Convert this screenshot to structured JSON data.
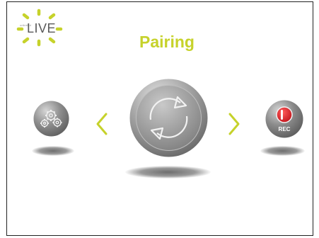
{
  "brand": {
    "name": "LIVE",
    "tagline": "unlimited"
  },
  "page": {
    "title": "Pairing"
  },
  "menu": {
    "items": [
      {
        "id": "settings",
        "icon": "gears-icon",
        "label": ""
      },
      {
        "id": "pairing",
        "icon": "sync-arrows-icon",
        "label": "Pairing",
        "selected": true
      },
      {
        "id": "record",
        "icon": "record-icon",
        "label": "REC"
      }
    ]
  },
  "nav": {
    "prev_icon": "chevron-left-icon",
    "next_icon": "chevron-right-icon"
  },
  "colors": {
    "accent": "#c6d22b",
    "record_red": "#e0212a",
    "orb_grey": "#8a8a8a",
    "text_grey": "#5a5a5a"
  }
}
